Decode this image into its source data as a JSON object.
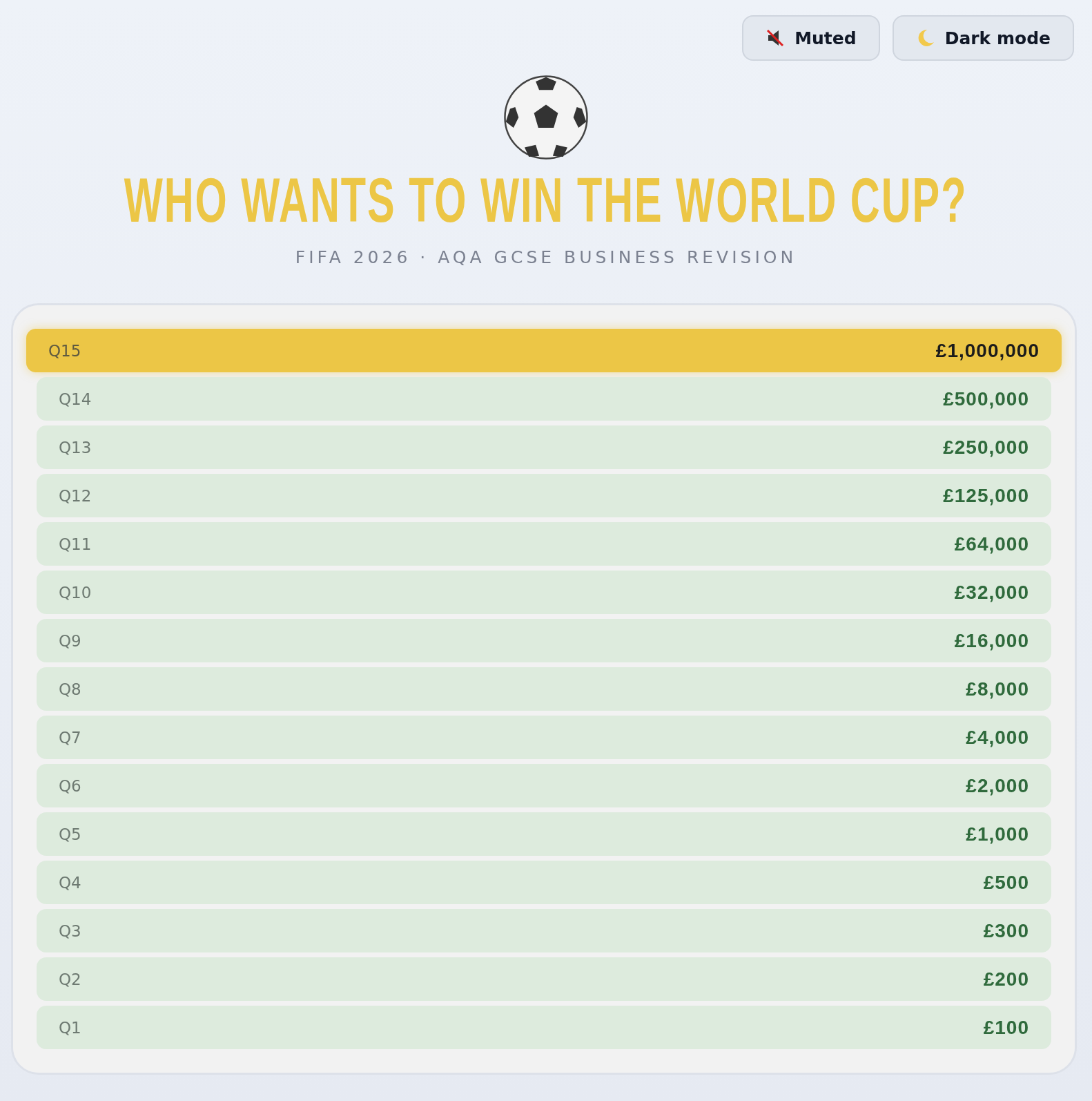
{
  "toolbar": {
    "buttons": [
      {
        "kind": "sound",
        "label": "Muted"
      },
      {
        "kind": "theme",
        "label": "Dark mode"
      }
    ]
  },
  "header": {
    "title": "WHO WANTS TO WIN THE WORLD CUP?",
    "subtitle": "FIFA 2026 · AQA GCSE BUSINESS REVISION"
  },
  "ladder": [
    {
      "question": "Q15",
      "prize": "£1,000,000",
      "selected": true
    },
    {
      "question": "Q14",
      "prize": "£500,000",
      "selected": false
    },
    {
      "question": "Q13",
      "prize": "£250,000",
      "selected": false
    },
    {
      "question": "Q12",
      "prize": "£125,000",
      "selected": false
    },
    {
      "question": "Q11",
      "prize": "£64,000",
      "selected": false
    },
    {
      "question": "Q10",
      "prize": "£32,000",
      "selected": false
    },
    {
      "question": "Q9",
      "prize": "£16,000",
      "selected": false
    },
    {
      "question": "Q8",
      "prize": "£8,000",
      "selected": false
    },
    {
      "question": "Q7",
      "prize": "£4,000",
      "selected": false
    },
    {
      "question": "Q6",
      "prize": "£2,000",
      "selected": false
    },
    {
      "question": "Q5",
      "prize": "£1,000",
      "selected": false
    },
    {
      "question": "Q4",
      "prize": "£500",
      "selected": false
    },
    {
      "question": "Q3",
      "prize": "£300",
      "selected": false
    },
    {
      "question": "Q2",
      "prize": "£200",
      "selected": false
    },
    {
      "question": "Q1",
      "prize": "£100",
      "selected": false
    }
  ]
}
